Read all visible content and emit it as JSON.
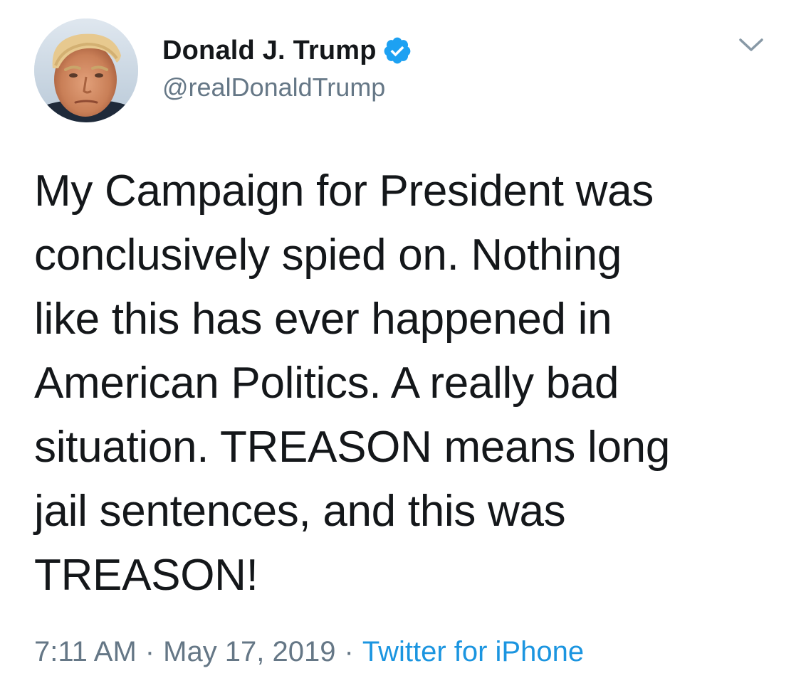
{
  "author": {
    "display_name": "Donald J. Trump",
    "handle": "@realDonaldTrump",
    "verified": true,
    "avatar_icon": "profile-photo"
  },
  "menu": {
    "caret_icon": "chevron-down-icon"
  },
  "tweet": {
    "lines": [
      "My Campaign for President was",
      "conclusively spied on. Nothing",
      "like this has ever happened in",
      "American Politics. A really bad",
      "situation. TREASON means long",
      "jail sentences, and this was",
      "TREASON!"
    ]
  },
  "meta": {
    "time": "7:11 AM",
    "separator": "·",
    "date": "May 17, 2019",
    "source": "Twitter for iPhone"
  },
  "colors": {
    "text": "#14171a",
    "secondary": "#657786",
    "link": "#1b95e0",
    "verified_badge": "#1da1f2"
  }
}
